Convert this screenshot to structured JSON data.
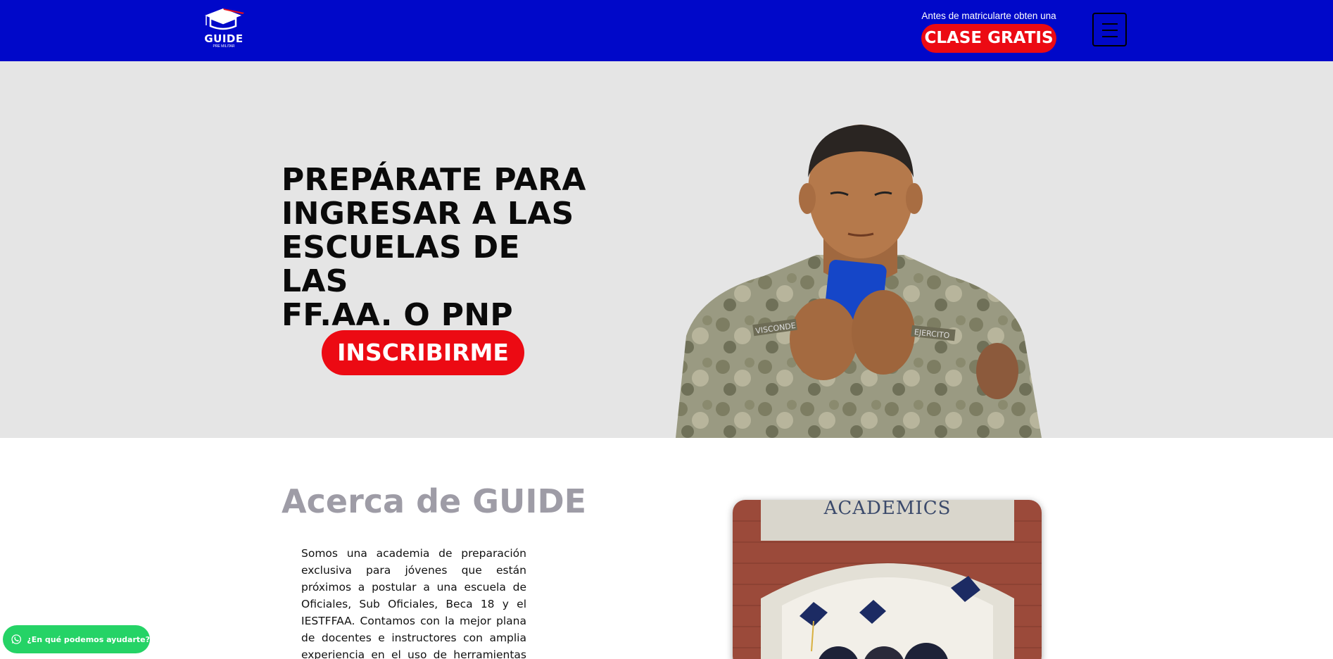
{
  "header": {
    "logo_text": "GUIDE",
    "logo_subtext": "PRE MILITAR",
    "promo_text": "Antes de matricularte obten una",
    "promo_button": "CLASE GRATIS"
  },
  "hero": {
    "title_lines": [
      "PREPÁRATE PARA",
      "INGRESAR A LAS",
      "ESCUELAS DE LAS",
      "FF.AA. O PNP"
    ],
    "cta_button": "INSCRIBIRME",
    "uniform_tags": [
      "VISCONDE",
      "EJERCITO"
    ]
  },
  "about": {
    "title": "Acerca de GUIDE",
    "paragraph": "Somos una academia de preparación exclusiva para jóvenes que están próximos a postular a una escuela de Oficiales, Sub Oficiales, Beca 18 y el IESTFFAA. Contamos con la mejor plana de docentes e instructores con amplia experiencia en el uso de herramientas digitales, además de",
    "image_sign": "ACADEMICS"
  },
  "whatsapp": {
    "label": "¿En qué podemos ayudarte?"
  },
  "colors": {
    "header_bg": "#0008c9",
    "accent_red": "#ec0a13",
    "hero_bg": "#e5e5e5",
    "about_title": "#9e9ca6",
    "whatsapp_green": "#25d366"
  },
  "icons": {
    "logo": "graduation-cap-icon",
    "menu": "hamburger-menu-icon",
    "whatsapp": "whatsapp-icon"
  }
}
